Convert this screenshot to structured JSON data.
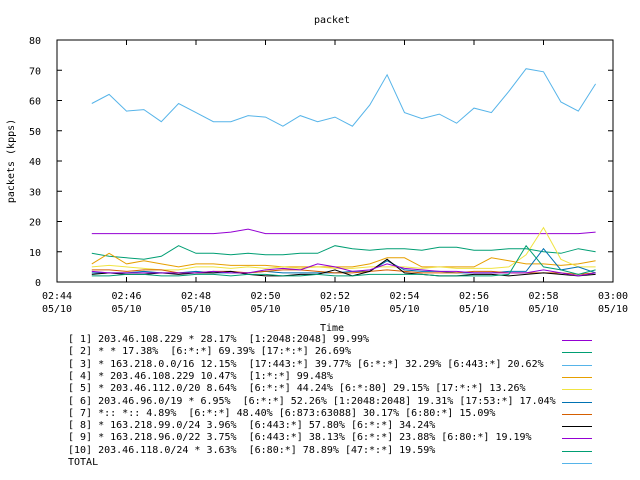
{
  "chart_data": {
    "type": "line",
    "title": "packet",
    "xlabel": "Time",
    "ylabel": "packets (kpps)",
    "ylim": [
      0,
      80
    ],
    "yticks": [
      0,
      10,
      20,
      30,
      40,
      50,
      60,
      70,
      80
    ],
    "xlim": [
      "02:44",
      "03:00"
    ],
    "xticks": [
      {
        "time": "02:44",
        "date": "05/10"
      },
      {
        "time": "02:46",
        "date": "05/10"
      },
      {
        "time": "02:48",
        "date": "05/10"
      },
      {
        "time": "02:50",
        "date": "05/10"
      },
      {
        "time": "02:52",
        "date": "05/10"
      },
      {
        "time": "02:54",
        "date": "05/10"
      },
      {
        "time": "02:56",
        "date": "05/10"
      },
      {
        "time": "02:58",
        "date": "05/10"
      },
      {
        "time": "03:00",
        "date": "05/10"
      }
    ],
    "x": [
      "02:45:00",
      "02:45:30",
      "02:46:00",
      "02:46:30",
      "02:47:00",
      "02:47:30",
      "02:48:00",
      "02:48:30",
      "02:49:00",
      "02:49:30",
      "02:50:00",
      "02:50:30",
      "02:51:00",
      "02:51:30",
      "02:52:00",
      "02:52:30",
      "02:53:00",
      "02:53:30",
      "02:54:00",
      "02:54:30",
      "02:55:00",
      "02:55:30",
      "02:56:00",
      "02:56:30",
      "02:57:00",
      "02:57:30",
      "02:58:00",
      "02:58:30",
      "02:59:00",
      "02:59:30"
    ],
    "legend_position": "bottom",
    "series": [
      {
        "name": "[ 1] 203.46.108.229 * 28.17%  [1:2048:2048] 99.99%",
        "color": "#9400d3",
        "values": [
          16,
          16,
          16,
          16,
          16,
          16,
          16,
          16,
          16.5,
          17.5,
          16,
          16,
          16,
          16,
          16,
          16,
          16,
          16,
          16,
          16,
          16,
          16,
          16,
          16,
          16,
          16,
          16,
          16,
          16,
          16.5
        ]
      },
      {
        "name": "[ 2] * * 17.38%  [6:*:*] 69.39% [17:*:*] 26.69%",
        "color": "#009e73",
        "values": [
          9.5,
          8.5,
          8,
          7.5,
          8.5,
          12,
          9.5,
          9.5,
          9,
          9.5,
          9,
          9,
          9.5,
          9.5,
          12,
          11,
          10.5,
          11,
          11,
          10.5,
          11.5,
          11.5,
          10.5,
          10.5,
          11,
          11,
          10,
          9.5,
          11,
          10
        ]
      },
      {
        "name": "[ 3] * 163.218.0.0/16 12.15%  [17:443:*] 39.77% [6:*:*] 32.29% [6:443:*] 20.62%",
        "color": "#56b4e9",
        "values": [
          59,
          62,
          56.5,
          57,
          53,
          59,
          56,
          53,
          53,
          55,
          54.5,
          51.5,
          55,
          53,
          54.5,
          51.5,
          58.5,
          68.5,
          56,
          54,
          55.5,
          52.5,
          57.5,
          56,
          63,
          70.5,
          69.5,
          59.5,
          56.5,
          65.5
        ]
      },
      {
        "name": "[ 4] * 203.46.108.229 10.47%  [1:*:*] 99.48%",
        "color": "#e69f00",
        "values": [
          6,
          9.5,
          6,
          7,
          6,
          5,
          6,
          6,
          5.5,
          5.5,
          5.5,
          5,
          5,
          5,
          5,
          5,
          6,
          8,
          8,
          5,
          5,
          5,
          5,
          8,
          7,
          6,
          6,
          5.5,
          6,
          7
        ]
      },
      {
        "name": "[ 5] * 203.46.112.0/20 8.64%  [6:*:*] 44.24% [6:*:80] 29.15% [17:*:*] 13.26%",
        "color": "#f0e442",
        "values": [
          5,
          5.5,
          5,
          4.5,
          4,
          4,
          5,
          5,
          4.5,
          5,
          4.5,
          5,
          4.5,
          5,
          4.5,
          4.5,
          5,
          5,
          5,
          4.5,
          5,
          4.5,
          4.5,
          4.5,
          5,
          9,
          18,
          7.5,
          5,
          5
        ]
      },
      {
        "name": "[ 6] 203.46.96.0/19 * 6.95%  [6:*:*] 52.26% [1:2048:2048] 19.31% [17:53:*] 17.04%",
        "color": "#0072b2",
        "values": [
          3,
          3,
          3,
          3.5,
          3,
          3,
          3.5,
          3,
          3,
          3,
          3.5,
          3,
          3,
          3,
          3,
          3.5,
          3.5,
          7,
          4,
          3.5,
          3.5,
          3,
          3,
          3,
          3.5,
          3.5,
          11,
          4,
          5,
          3
        ]
      },
      {
        "name": "[ 7] *:: *:: 4.89%  [6:*:*] 48.40% [6:873:63088] 30.17% [6:80:*] 15.09%",
        "color": "#d55e00",
        "values": [
          4,
          4,
          3.5,
          4,
          4,
          3,
          3,
          3.5,
          3.5,
          3,
          3.5,
          4,
          4,
          3.5,
          3,
          3,
          3.5,
          4,
          3.5,
          3,
          3,
          3,
          3.5,
          3.5,
          3,
          3,
          3,
          3,
          2.5,
          3
        ]
      },
      {
        "name": "[ 8] * 163.218.99.0/24 3.96%  [6:443:*] 57.80% [6:*:*] 34.24%",
        "color": "#000000",
        "values": [
          2.5,
          3,
          2.5,
          2.5,
          3,
          2.5,
          3,
          3,
          3.5,
          2.5,
          2,
          2,
          2.5,
          2.5,
          4,
          2,
          3.5,
          7.5,
          3,
          2.5,
          2,
          2,
          2.5,
          2.5,
          2,
          2.5,
          3,
          2.5,
          2,
          2.5
        ]
      },
      {
        "name": "[ 9] * 163.218.96.0/22 3.75%  [6:443:*] 38.13% [6:*:*] 23.88% [6:80:*] 19.19%",
        "color": "#9400d3",
        "values": [
          3.5,
          3,
          3,
          3,
          3,
          3,
          3,
          3.5,
          3,
          3,
          4,
          4.5,
          4,
          6,
          5,
          3.5,
          4,
          6,
          4.5,
          4,
          3.5,
          3.5,
          3,
          3,
          3,
          3,
          4,
          3,
          2,
          3
        ]
      },
      {
        "name": "[10] 203.46.118.0/24 * 3.63%  [6:80:*] 78.89% [47:*:*] 19.59%",
        "color": "#009e73",
        "values": [
          2,
          2,
          2.5,
          2.5,
          2,
          2,
          2.5,
          2.5,
          2,
          2.5,
          2.5,
          2,
          2,
          2.5,
          2,
          2,
          2.5,
          2.5,
          2.5,
          2.5,
          2,
          2,
          2,
          2,
          2.5,
          12,
          5,
          4,
          2.5,
          4
        ]
      },
      {
        "name": "TOTAL",
        "color": "#56b4e9",
        "values": []
      }
    ]
  }
}
